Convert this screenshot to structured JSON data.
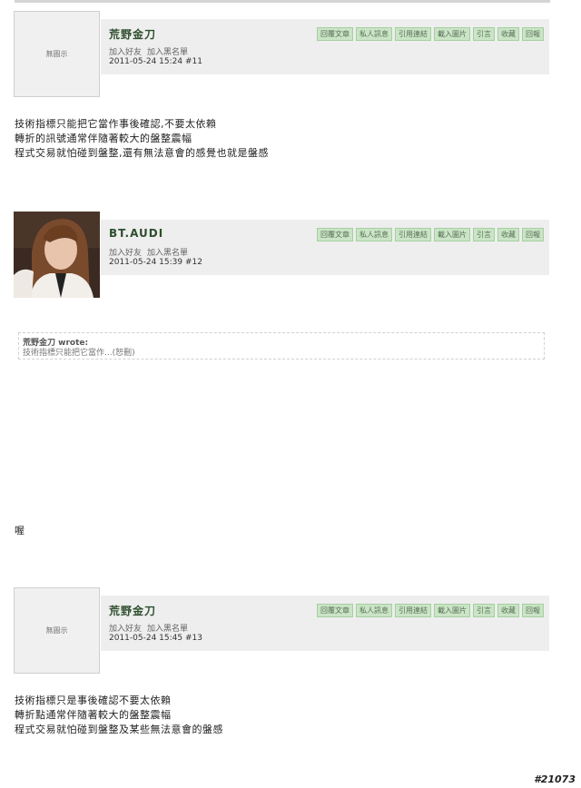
{
  "posts": [
    {
      "username": "荒野金刀",
      "avatar_text": "無圖示",
      "add_friend": "加入好友",
      "add_blacklist": "加入黑名單",
      "datetime_floor": "2011-05-24 15:24  #11",
      "actions": [
        "回覆文章",
        "私人訊息",
        "引用連結",
        "載入圖片",
        "引言",
        "收藏",
        "回報"
      ],
      "body": [
        "技術指標只能把它當作事後確認,不要太依賴",
        "轉折的訊號通常伴隨著較大的盤整震幅",
        "程式交易就怕碰到盤整,還有無法意會的感覺也就是盤感"
      ]
    },
    {
      "username": "BT.AUDI",
      "add_friend": "加入好友",
      "add_blacklist": "加入黑名單",
      "datetime_floor": "2011-05-24 15:39  #12",
      "actions": [
        "回覆文章",
        "私人訊息",
        "引用連結",
        "載入圖片",
        "引言",
        "收藏",
        "回報"
      ],
      "quote": {
        "author": "荒野金刀  wrote:",
        "text": "技術指標只能把它當作...(恕刪)"
      },
      "body": [
        "喔"
      ]
    },
    {
      "username": "荒野金刀",
      "avatar_text": "無圖示",
      "add_friend": "加入好友",
      "add_blacklist": "加入黑名單",
      "datetime_floor": "2011-05-24 15:45  #13",
      "actions": [
        "回覆文章",
        "私人訊息",
        "引用連結",
        "載入圖片",
        "引言",
        "收藏",
        "回報"
      ],
      "body": [
        "技術指標只是事後確認不要太依賴",
        "轉折點通常伴隨著較大的盤整震幅",
        "程式交易就怕碰到盤整及某些無法意會的盤感"
      ]
    }
  ],
  "watermark": "#21073"
}
